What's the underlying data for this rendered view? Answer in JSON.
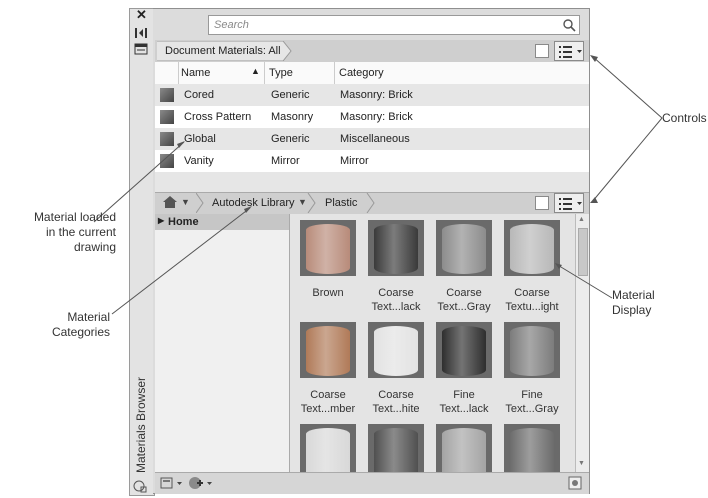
{
  "palette": {
    "title": "Materials Browser",
    "close_glyph": "✕",
    "search": {
      "placeholder": "Search"
    }
  },
  "document_materials": {
    "breadcrumb": "Document Materials: All",
    "columns": [
      "Name",
      "Type",
      "Category"
    ],
    "rows": [
      {
        "name": "Cored",
        "type": "Generic",
        "category": "Masonry: Brick"
      },
      {
        "name": "Cross Pattern",
        "type": "Masonry",
        "category": "Masonry: Brick"
      },
      {
        "name": "Global",
        "type": "Generic",
        "category": "Miscellaneous"
      },
      {
        "name": "Vanity",
        "type": "Mirror",
        "category": "Mirror"
      }
    ]
  },
  "library": {
    "breadcrumb": [
      "Autodesk Library",
      "Plastic"
    ],
    "tree_item": "Home",
    "tiles": [
      {
        "label": "Brown",
        "tone": "#b88b7a"
      },
      {
        "label": "Coarse\nText...lack",
        "tone": "#3a3a3a"
      },
      {
        "label": "Coarse\nText...Gray",
        "tone": "#8c8c8c"
      },
      {
        "label": "Coarse\nTextu...ight",
        "tone": "#b8b8b8"
      },
      {
        "label": "Coarse\nText...mber",
        "tone": "#b07a58"
      },
      {
        "label": "Coarse\nText...hite",
        "tone": "#e2e2e2"
      },
      {
        "label": "Fine\nText...lack",
        "tone": "#2e2e2e"
      },
      {
        "label": "Fine\nText...Gray",
        "tone": "#7c7c7c"
      },
      {
        "label": "",
        "tone": "#d8d8d8"
      },
      {
        "label": "",
        "tone": "#505050"
      },
      {
        "label": "",
        "tone": "#a4a4a4"
      },
      {
        "label": "",
        "tone": "#6c6c6c"
      }
    ]
  },
  "annotations": {
    "controls": "Controls",
    "material_loaded": "Material loaded\nin the current\ndrawing",
    "material_categories": "Material\nCategories",
    "material_display": "Material\nDisplay"
  }
}
